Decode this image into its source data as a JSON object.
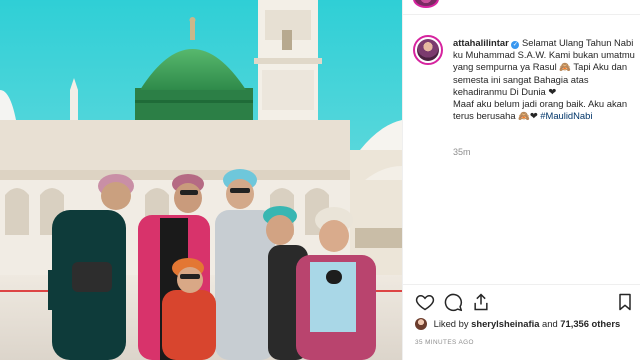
{
  "photo": {
    "alt": "Family photo in front of the Prophet's Mosque"
  },
  "post": {
    "username": "attahalilintar",
    "caption_text": "Selamat Ulang Tahun Nabi ku Muhammad S.A.W. Kami bukan umatmu yang sempurna ya Rasul 🙈 Tapi Aku dan semesta ini sangat Bahagia atas kehadiranmu Di Dunia ❤",
    "caption_text_2": "Maaf aku belum jadi orang baik. Aku akan terus berusaha 🙈❤",
    "hashtag": "#MaulidNabi",
    "time_ago": "35m"
  },
  "engagement": {
    "liked_by_prefix": "Liked by",
    "liked_by_user": "sherylsheinafia",
    "and": "and",
    "others": "71,356 others",
    "posted_time": "35 minutes ago"
  },
  "icons": [
    "heart-icon",
    "comment-icon",
    "share-icon",
    "bookmark-icon",
    "verified-icon"
  ],
  "colors": {
    "link": "#003569",
    "text": "#262626",
    "muted": "#8e8e8e",
    "verified": "#3897f0",
    "story_ring": "#d6249f"
  }
}
